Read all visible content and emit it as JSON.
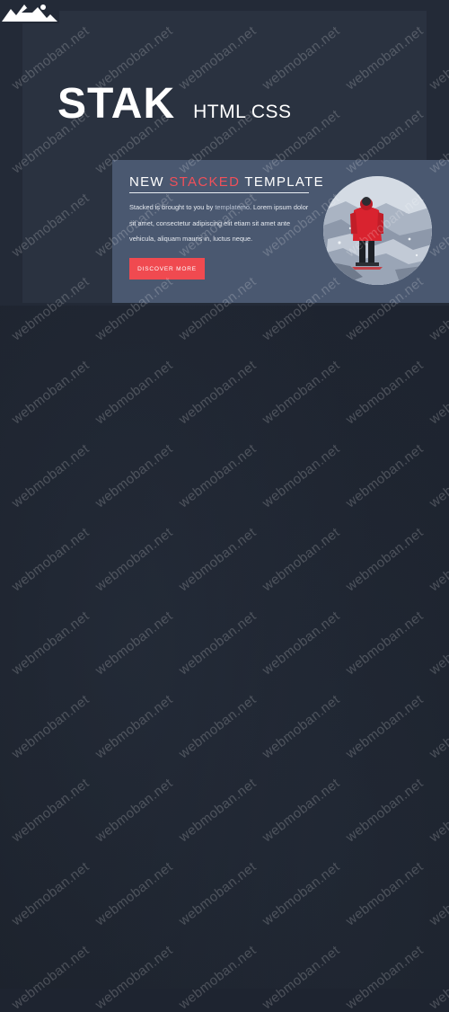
{
  "header": {
    "logo_icon": "mountain-logo-icon",
    "brand_title": "STAK",
    "brand_subtitle": "HTML CSS"
  },
  "feature": {
    "heading_prefix": "NEW ",
    "heading_accent": "STACKED",
    "heading_suffix": " TEMPLATE",
    "body_before_link": "Stacked is brought to you by ",
    "body_link": "templatemo",
    "body_after_link": ". Lorem ipsum dolor sit amet, consectetur adipiscing elit etiam sit amet ante vehicula, aliquam mauris in, luctus neque.",
    "button_label": "DISCOVER MORE",
    "photo_icon": "hiker-photo"
  },
  "watermark": {
    "text": "webmoban.net"
  },
  "colors": {
    "background": "#1e2430",
    "card": "#4a5870",
    "accent": "#f04a50"
  }
}
